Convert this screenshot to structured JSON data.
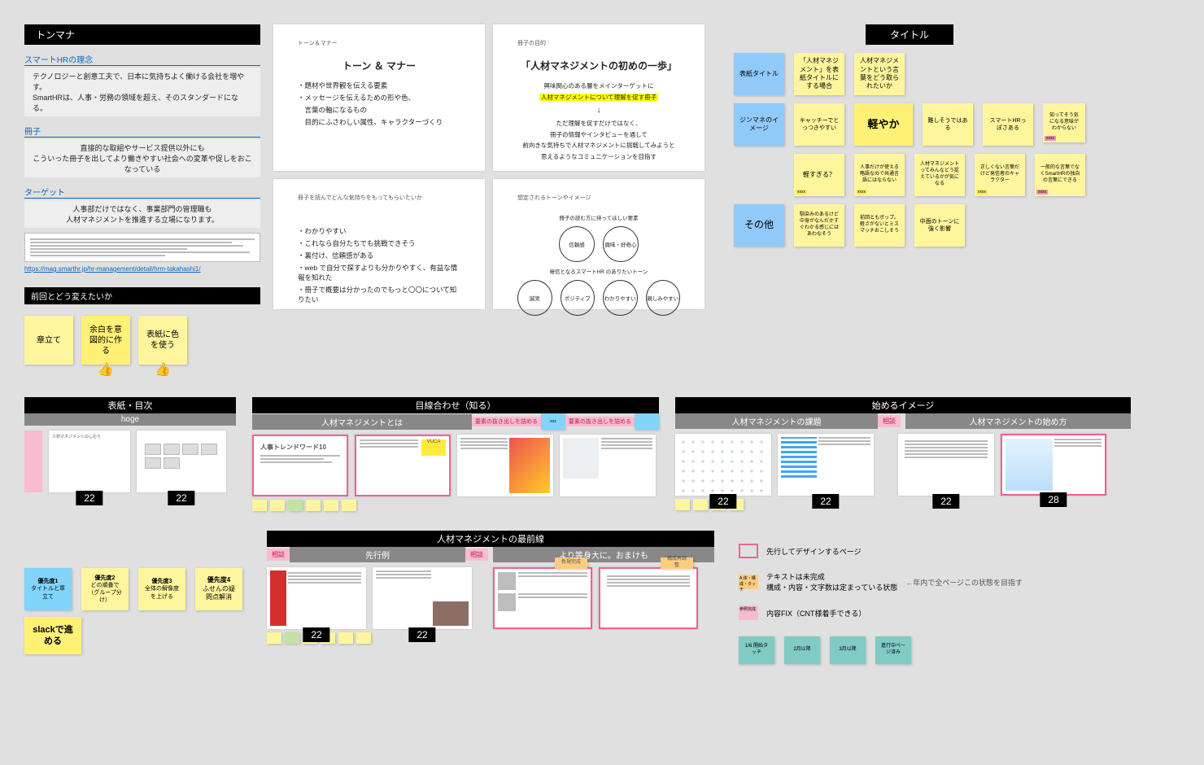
{
  "top": {
    "tonmana_tag": "トンマナ",
    "smarthr_heading": "スマートHRの理念",
    "smarthr_body": "テクノロジーと創意工夫で、日本に気持ちよく働ける会社を増やす。\nSmartHRは、人事・労務の領域を超え、そのスタンダードになる。",
    "booklet_heading": "冊子",
    "booklet_body": "直接的な取組やサービス提供以外にも\nこういった冊子を出してより働きやすい社会への変革や促しをおこなっている",
    "target_heading": "ターゲット",
    "target_body": "人事部だけではなく、事業部門の管理職も\n人材マネジメントを推進する立場になります。",
    "external_link": "https://mag.smarthr.jp/hr-management/detail/hrm-takahashi1/",
    "prev_tag": "前回とどう変えたいか",
    "prev_stickies": [
      "章立て",
      "余白を意図的に作る",
      "表紙に色を使う"
    ]
  },
  "slides": {
    "s1_crumb": "トーン＆マナー",
    "s1_title": "トーン ＆ マナー",
    "s1_items": [
      "・題材や世界観を伝える要素",
      "・メッセージを伝えるための形や色、",
      "　言葉の軸になるもの",
      "　目的にふさわしい属性、キャラクターづくり"
    ],
    "s2_crumb": "冊子の目的",
    "s2_title": "「人材マネジメントの初めの一歩」",
    "s2_sub1": "興味関心のある層をメインターゲットに",
    "s2_sub2_hl": "人材マネジメントについて理解を促す冊子",
    "s2_body": "ただ理解を促すだけではなく、\n冊子の情報やインタビューを通して\n前向きな気持ちで人材マネジメントに挑戦してみようと\n思えるようなコミュニケーションを目指す",
    "s3_crumb": "冊子を読んでどんな気持ちをもってもらいたいか",
    "s3_items": [
      "・わかりやすい",
      "・これなら自分たちでも挑戦できそう",
      "・裏付け、信頼感がある",
      "・web で自分で探すよりも分かりやすく、有益な情報を知れた",
      "・冊子で概要は分かったのでもっと〇〇について知りたい"
    ],
    "s4_crumb": "想定されるトーンやイメージ",
    "s4_cap1": "冊子の読む方に持ってほしい要素",
    "s4_row1": [
      "信頼感",
      "興味・好奇心"
    ],
    "s4_cap2": "発信となるスマートHR のありたいトーン",
    "s4_row2": [
      "誠実",
      "ポジティブ",
      "わかりやすい",
      "親しみやすい"
    ]
  },
  "title_panel": {
    "tag": "タイトル",
    "row1_label": "表紙タイトル",
    "row1": [
      "「人材マネジメント」を表紙タイトルにする場合",
      "人材マネジメントという言葉をどう取られたいか"
    ],
    "row2_label": "ジンマネのイメージ",
    "row2": [
      "キャッチーでとっつきやすい",
      "軽やか",
      "難しそうではある",
      "スマートHRっぽさある"
    ],
    "row2_extra": "知ってそう気になる意味がわからない",
    "row3": [
      "軽すぎる？",
      "人事だけが使える略語なので共通言語にはならない",
      "人材マネジメントってみんなどう捉えているかが気になる",
      "正しくない言葉だけど発信者のキャラクター",
      "一般的な言葉でなくSmartHRの独自の言葉にできる"
    ],
    "row4_label": "その他",
    "row4": [
      "馴染みのあるけど中身がなんだかすぐわかる感じにはあわなそう",
      "前回ともポップ。軽さがないとミスマッチおこしそう",
      "中面のトーンに強く影響"
    ]
  },
  "sections": {
    "a_title": "表紙・目次",
    "a_sub": "hoge",
    "b_title": "目線合わせ（知る）",
    "b_sub": "人材マネジメントとは",
    "c_title": "始めるイメージ",
    "c_sub1": "人材マネジメントの課題",
    "c_sub2": "人材マネジメントの始め方",
    "d_title": "人材マネジメントの最前線",
    "d_sub1": "先行例",
    "d_sub2": "より等身大に。おまけも",
    "soudan": "相談",
    "page_thumb_title": "人材マネジメントのしおり",
    "trend_word": "人事トレンドワード10",
    "vuca": "VUCA",
    "pk_tags": [
      "要素の抜き出しを詰める",
      "xxx",
      "要素の抜き出しを詰める"
    ],
    "or_tags": [
      "新規完成",
      "構成再調整"
    ]
  },
  "priorities": {
    "items": [
      {
        "t": "優先度1",
        "b": "タイトルと章立て"
      },
      {
        "t": "優先度2",
        "b": "どの順番で（グループ分け）"
      },
      {
        "t": "優先度3",
        "b": "全体の解像度を上げる"
      },
      {
        "t": "優先度4",
        "b": "ふせんの疑問点解消"
      }
    ],
    "slack": "slackで進める"
  },
  "legend": {
    "red": "先行してデザインするページ",
    "orange_t": "A.体・構成・タッチ",
    "orange": "テキストは未完成\n構成・内容・文字数は定まっている状態",
    "orange_note": "←年内で全ページこの状態を目指す",
    "pink_t": "参照完成",
    "pink": "内容FIX（CNT様着手できる）",
    "teal_items": [
      "1/6 開始タッチ",
      "2月以降",
      "3月以降",
      "進行中ページ済み"
    ]
  },
  "badges": {
    "n22": "22",
    "n28": "28"
  }
}
